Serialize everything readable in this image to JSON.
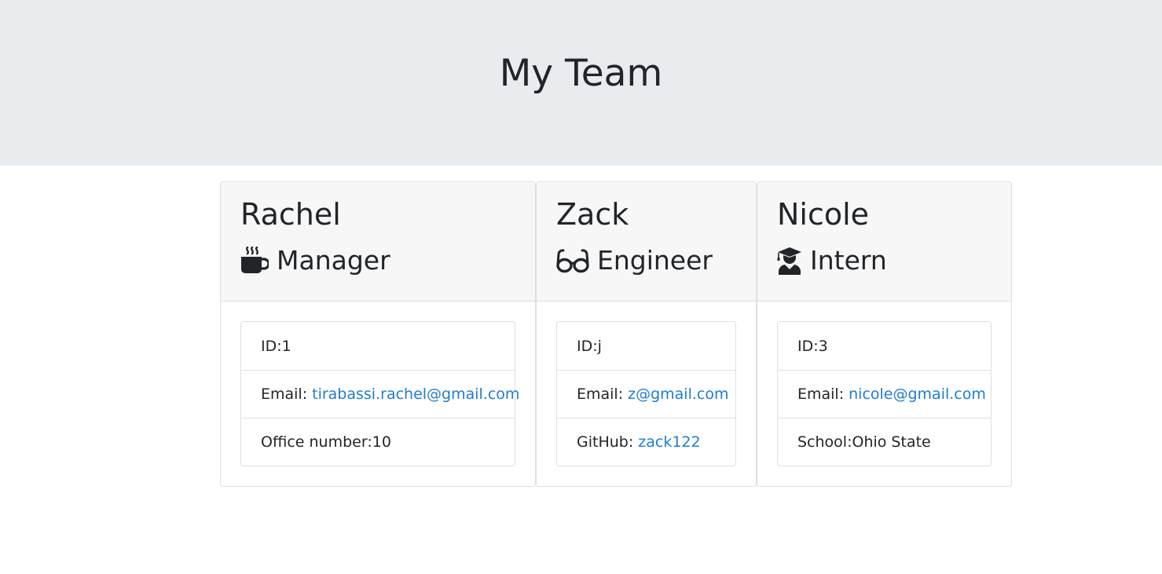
{
  "header": {
    "title": "My Team"
  },
  "team": [
    {
      "name": "Rachel",
      "role": "Manager",
      "icon": "mug-hot-icon",
      "id_label": "ID: ",
      "id": "1",
      "email_label": "Email:",
      "email": "tirabassi.rachel@gmail.com",
      "extra_label": "Office number: ",
      "extra_value": "10"
    },
    {
      "name": "Zack",
      "role": "Engineer",
      "icon": "glasses-icon",
      "id_label": "ID: ",
      "id": "j",
      "email_label": "Email:",
      "email": "z@gmail.com",
      "extra_label": "GitHub:",
      "extra_value": "zack122"
    },
    {
      "name": "Nicole",
      "role": "Intern",
      "icon": "user-graduate-icon",
      "id_label": "ID: ",
      "id": "3",
      "email_label": "Email:",
      "email": "nicole@gmail.com",
      "extra_label": "School: ",
      "extra_value": "Ohio State"
    }
  ],
  "colors": {
    "jumbotron_bg": "#e9ecef",
    "card_header_bg": "#f7f7f7",
    "link": "#1f7bd4",
    "text": "#212529"
  }
}
